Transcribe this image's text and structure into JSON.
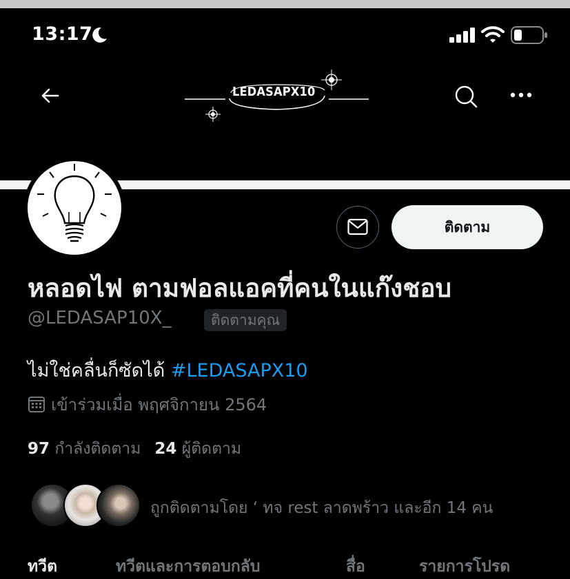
{
  "status_bar": {
    "time": "13:17",
    "icons": [
      "moon-icon",
      "signal-icon",
      "wifi-icon",
      "battery-icon"
    ]
  },
  "nav": {
    "logo_text": "LEDASAPX10",
    "icons": [
      "back-arrow-icon",
      "search-icon",
      "more-icon"
    ]
  },
  "profile": {
    "display_name": "หลอดไฟ ตามฟอลแอคที่คนในแก๊งชอบ",
    "handle": "@LEDASAP10X_",
    "follows_you_badge": "ติดตามคุณ",
    "follow_button": "ติดตาม",
    "bio_text": "ไม่ใช่คลื่นก็ซัดได้ ",
    "bio_hashtag": "#LEDASAPX10",
    "joined": "เข้าร่วมเมื่อ พฤศจิกายน 2564",
    "following_count": "97",
    "following_label": "กำลังติดตาม",
    "followers_count": "24",
    "followers_label": "ผู้ติดตาม",
    "followed_by": "ถูกติดตามโดย ‘ ทจ rest ลาดพร้าว และอีก 14 คน"
  },
  "tabs": [
    "ทวีต",
    "ทวีตและการตอบกลับ",
    "สื่อ",
    "รายการโปรด"
  ],
  "colors": {
    "background": "#000000",
    "accent": "#1d9bf0",
    "muted_text": "#71767b",
    "follow_button_bg": "#eff3f4"
  }
}
